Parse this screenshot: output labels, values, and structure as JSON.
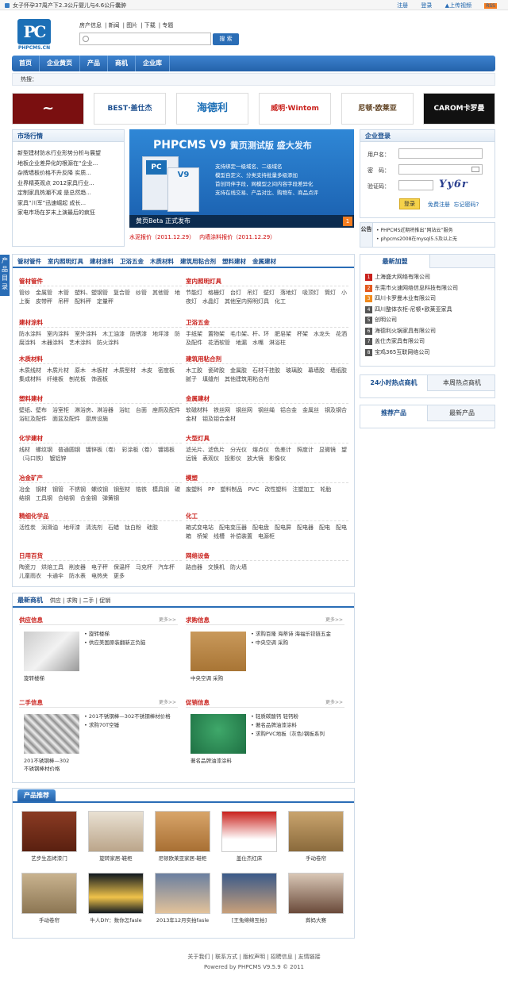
{
  "topbar": {
    "news": "女子怀孕37周产下2.3公斤婴儿与4.6公斤囊肿",
    "register": "注册",
    "login": "登录",
    "upload": "上传视频",
    "rss": "RSS"
  },
  "logo": {
    "mark": "PC",
    "text": "PHPCMS.CN"
  },
  "channels": [
    "房产信息",
    "新闻",
    "图片",
    "下载",
    "专题"
  ],
  "search": {
    "button": "搜 索",
    "value": ""
  },
  "nav": [
    "首页",
    "企业黄页",
    "产品",
    "商机",
    "企业库"
  ],
  "hot": {
    "label": "热搜："
  },
  "banners": [
    "",
    "BEST·盖仕杰",
    "海德利",
    "威明·Wintom",
    "尼顿·欧莱亚",
    "CAROM卡罗曼"
  ],
  "market": {
    "title": "市场行情",
    "items": [
      "新型建材防水行业形势分析与展望",
      "地板企业差异化的根源在“企业...",
      "杂牌墙板价格不升反降 实质...",
      "业界精英观点 2012家具行业...",
      "定制家具热潮不减 是总然趋...",
      "家具“川军”迅速崛起 成长...",
      "家电市场在岁末上演最后的疯狂"
    ]
  },
  "slide": {
    "title": "PHPCMS V9",
    "subtitle": "黄页测试版 盛大发布",
    "box_logo": "PC",
    "box_v": "V9",
    "lines": [
      "支持绑定一级域名、二级域名",
      "模型自定义、分类支持批量多级添加",
      "首创同伴字段，网模型之间内容字段差异化",
      "支持在线交易、产品对比、购物车、商品点评"
    ],
    "caption": "黄页Beta 正式发布",
    "num": "1"
  },
  "prices": [
    "水泥报价（2011.12.29）",
    "内墙涂料报价（2011.12.29）"
  ],
  "login": {
    "title": "企业登录",
    "username_label": "用户名：",
    "password_label": "密　码：",
    "captcha_label": "验证码：",
    "captcha": "Yy6r",
    "button": "登录",
    "free_reg": "免费注册",
    "forgot": "忘记密码?"
  },
  "notice": {
    "label": "公告",
    "items": [
      "PHPCMS近期将推出“网站云”服务",
      "phpcms2008在mysql5.5及以上无"
    ]
  },
  "sidetab": "产品目录",
  "cats": {
    "head": [
      "管材管件",
      "室内照明灯具",
      "建材涂料",
      "卫浴五金",
      "木质材料",
      "建筑用粘合剂",
      "塑料建材",
      "金属建材"
    ],
    "blocks": [
      {
        "t": "管材管件",
        "i": "管纱　金属管　木管　塑料、塑钢管　复合管　纱管　其他管　地上衡　皮带秤　吊秤　配料秤　定量秤"
      },
      {
        "t": "室内照明灯具",
        "i": "节能灯　格栅灯　台灯　吊灯　壁灯　落地灯　吸顶灯　筒灯　小夜灯　水晶灯　其他室内照明灯具　化工"
      },
      {
        "t": "建材涂料",
        "i": "防水涂料　室内涂料　室外涂料　木工油漆　防锈漆　地坪漆　防腐涂料　木器涂料　艺术涂料　防火涂料"
      },
      {
        "t": "卫浴五金",
        "i": "手纸架　置物架　毛巾架、杆、环　肥皂架　杯架　水龙头　花洒及配件　花洒软管　地漏　水嘴　淋浴柱"
      },
      {
        "t": "木质材料",
        "i": "木质线材　木质片材　原木　木板材　木质型材　木皮　密度板　集成材料　纤维板　刨花板　饰面板"
      },
      {
        "t": "建筑用粘合剂",
        "i": "木工胶　瓷砖胶　金属胶　石材干挂胶　玻璃胶　幕墙胶　墙纸胶　腻子　填缝剂　其他建筑用粘合剂"
      },
      {
        "t": "塑料建材",
        "i": "壁纸、壁布　浴室柜　淋浴房、淋浴器　浴缸　台面　座厕及配件　浴缸及配件　面盆及配件　厨房设施"
      },
      {
        "t": "金属建材",
        "i": "软磁材料　铁丝网　钢丝网　钢丝绳　铝合金　金属丝　钢及钢合金材　钼及钼合金材"
      },
      {
        "t": "化学建材",
        "i": "线材　螺纹钢　普通圆钢　镀锌板（卷）　彩涂板（卷）　镀锡板（马口铁）　镀铝锌"
      },
      {
        "t": "大型灯具",
        "i": "滤光片、滤色片　分光仪　熔点仪　色差计　照度计　显微镜　望远镜　表观仪　投影仪　放大镜　影像仪"
      },
      {
        "t": "冶金矿产",
        "i": "冶金　钢材　钢管　不锈钢　螺纹钢　钢型材　锆铁　模具钢　碳结钢　工具钢　合结钢　合金钢　弹簧钢"
      },
      {
        "t": "模塑",
        "i": "废塑料　PP　塑料制品　PVC　改性塑料　注塑加工　轮胎"
      },
      {
        "t": "精细化学品",
        "i": "活性炭　润滑油　地坪漆　清洗剂　石蜡　钛白粉　硅胶"
      },
      {
        "t": "化工",
        "i": "箱式变电站　配电变压器　配电盘　配电屏　配电器　配电　配电箱　桥架　线槽　补偿装置　电源柜"
      },
      {
        "t": "日用百货",
        "i": "陶瓷刀　烘焙工具　削皮器　电子秤　保温杯　马克杯　汽车杯　儿童雨衣　卡通伞　防水表　电热夹　更多"
      },
      {
        "t": "网络设备",
        "i": "路由器　交换机　防火墙"
      }
    ]
  },
  "newest": {
    "title": "最新加盟",
    "items": [
      "上海盛大网络有限公司",
      "东莞市火速网络信息科技有限公司",
      "四川卡罗曼木业有限公司",
      "四川整体衣柜-尼顿•欧莱亚家具",
      "创明公司",
      "海德利火锅家具有限公司",
      "盖仕杰家具有限公司",
      "宝鸡365互联网络公司"
    ]
  },
  "hot24": {
    "tab1": "24小时热点商机",
    "tab2": "本周热点商机"
  },
  "recommend": {
    "tab1": "推荐产品",
    "tab2": "最新产品"
  },
  "biz": {
    "title": "最新商机",
    "tabs": [
      "供应",
      "求购",
      "二手",
      "促销"
    ],
    "more": "更多>>",
    "supply": {
      "t": "供应信息",
      "lines": [
        "• 旋转楼梯",
        "• 供应美国原装翻新正负脑"
      ],
      "cap": [
        "旋转楼梯"
      ]
    },
    "buy": {
      "t": "求购信息",
      "lines": [
        "• 求购百隆 海蒂诗 海福乐铰链五金",
        "• 中央空调 采购"
      ],
      "cap": [
        "中央空调 采购"
      ]
    },
    "second": {
      "t": "二手信息",
      "lines": [
        "• 201不锈钢棒—302不锈钢棒材价格",
        "• 求购70T空锤"
      ],
      "cap": [
        "201不锈钢棒—302",
        "不锈钢棒材价格"
      ]
    },
    "promo": {
      "t": "促销信息",
      "lines": [
        "• 轻质碳酸钙 轻钙粉",
        "• 著名品牌油漆涂料",
        "• 求购PVC地板（灰色)钢板系列"
      ],
      "cap": [
        "著名品牌油漆涂料"
      ]
    }
  },
  "products": {
    "title": "产品推荐",
    "items": [
      "艺步生态烤漆门",
      "旋转家居-鞋柜",
      "尼顿欧莱亚家居-鞋柜",
      "盖仕杰红床",
      "手动卷帘",
      "手动卷帘",
      "牛人DIY：数你怎fasle",
      "2013年12月实拍fasle",
      "[王兔绵绵互拍]",
      "葬妈大赛"
    ]
  },
  "footer": {
    "links": "关于我们 | 联系方式 | 版权声明 | 招聘信息 | 友情链接",
    "powered": "Powered by PHPCMS V9.5.9 © 2011"
  }
}
